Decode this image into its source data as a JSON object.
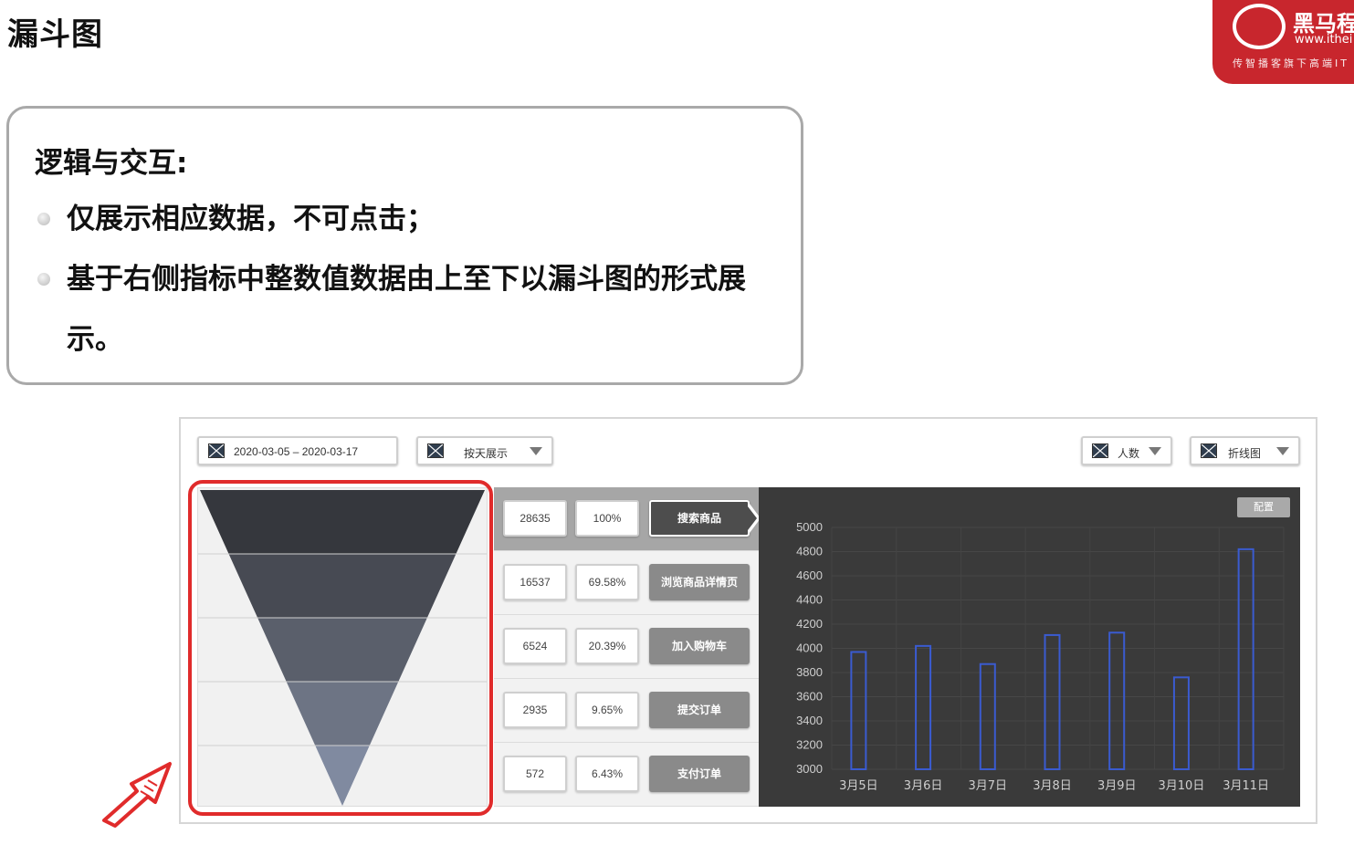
{
  "page": {
    "title": "漏斗图"
  },
  "logo": {
    "name": "黑马程",
    "url": "www.ithei",
    "tagline": "传智播客旗下高端IT"
  },
  "description": {
    "heading": "逻辑与交互:",
    "bullets": [
      "仅展示相应数据，不可点击；",
      "基于右侧指标中整数值数据由上至下以漏斗图的形式展示。"
    ]
  },
  "controls": {
    "date_range": "2020-03-05 – 2020-03-17",
    "granularity": "按天展示",
    "metric": "人数",
    "chart_type": "折线图"
  },
  "funnel": {
    "steps": [
      {
        "count": "28635",
        "percent": "100%",
        "label": "搜索商品",
        "value": 28635,
        "color": "#35373d",
        "active": true
      },
      {
        "count": "16537",
        "percent": "69.58%",
        "label": "浏览商品详情页",
        "value": 16537,
        "color": "#474a53",
        "active": false
      },
      {
        "count": "6524",
        "percent": "20.39%",
        "label": "加入购物车",
        "value": 6524,
        "color": "#5a5f6b",
        "active": false
      },
      {
        "count": "2935",
        "percent": "9.65%",
        "label": "提交订单",
        "value": 2935,
        "color": "#6d7484",
        "active": false
      },
      {
        "count": "572",
        "percent": "6.43%",
        "label": "支付订单",
        "value": 572,
        "color": "#808aa0",
        "active": false
      }
    ]
  },
  "chart": {
    "config_label": "配置",
    "colors": {
      "background": "#3a3a3a",
      "bar_stroke": "#3a5bd0",
      "axis_text": "#cfcfcf"
    }
  },
  "chart_data": {
    "type": "bar",
    "categories": [
      "3月5日",
      "3月6日",
      "3月7日",
      "3月8日",
      "3月9日",
      "3月10日",
      "3月11日"
    ],
    "values": [
      3970,
      4020,
      3870,
      4110,
      4130,
      3760,
      4820
    ],
    "ylim": [
      3000,
      5000
    ],
    "yticks": [
      3000,
      3200,
      3400,
      3600,
      3800,
      4000,
      4200,
      4400,
      4600,
      4800,
      5000
    ],
    "title": "",
    "xlabel": "",
    "ylabel": "",
    "grid": true
  }
}
